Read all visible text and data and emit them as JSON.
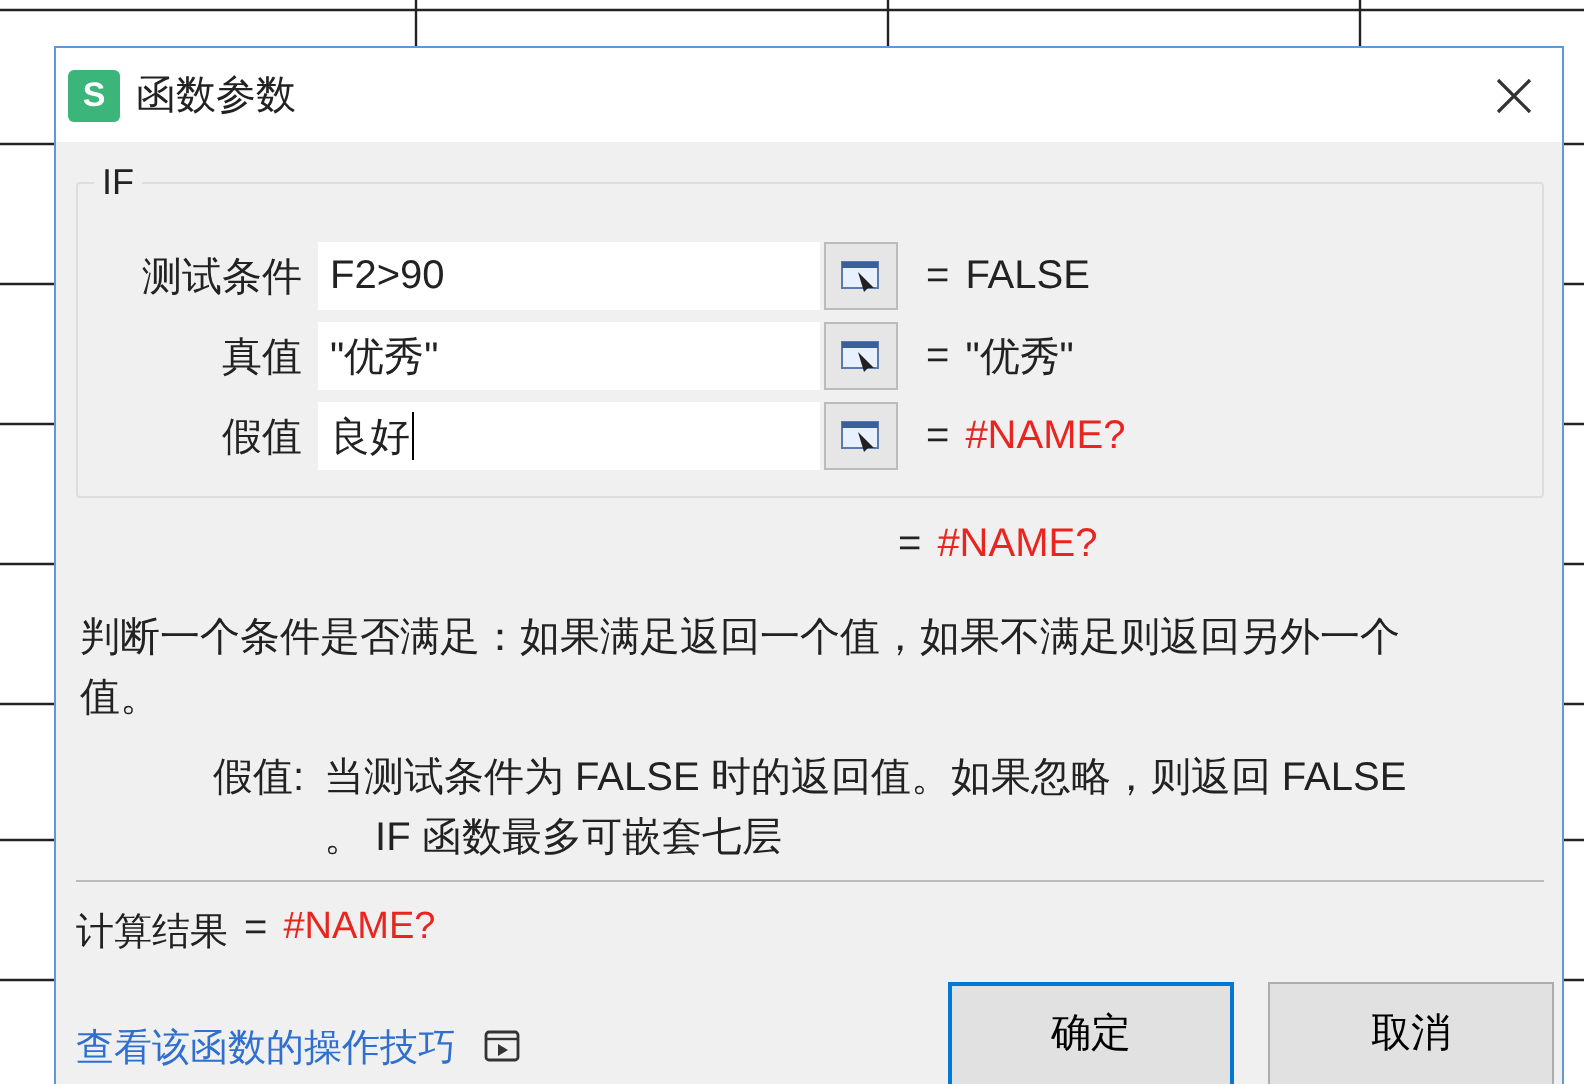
{
  "window": {
    "title": "函数参数",
    "app_icon": "S"
  },
  "function_name": "IF",
  "arguments": [
    {
      "label": "测试条件",
      "value": "F2>90",
      "equals": "=",
      "result": "FALSE",
      "error": false,
      "focused": false
    },
    {
      "label": "真值",
      "value": "\"优秀\"",
      "equals": "=",
      "result": "\"优秀\"",
      "error": false,
      "focused": false
    },
    {
      "label": "假值",
      "value": "良好",
      "equals": "=",
      "result": "#NAME?",
      "error": true,
      "focused": true
    }
  ],
  "formula_result": {
    "equals": "=",
    "value": "#NAME?",
    "error": true
  },
  "description": "判断一个条件是否满足：如果满足返回一个值，如果不满足则返回另外一个值。",
  "argument_help": {
    "label": "假值:",
    "text": "当测试条件为 FALSE 时的返回值。如果忽略，则返回 FALSE 。 IF 函数最多可嵌套七层"
  },
  "calculation_result": {
    "label": "计算结果",
    "equals": "=",
    "value": "#NAME?",
    "error": true
  },
  "help_link": "查看该函数的操作技巧",
  "buttons": [
    {
      "label": "确定",
      "default": true
    },
    {
      "label": "取消",
      "default": false
    }
  ]
}
